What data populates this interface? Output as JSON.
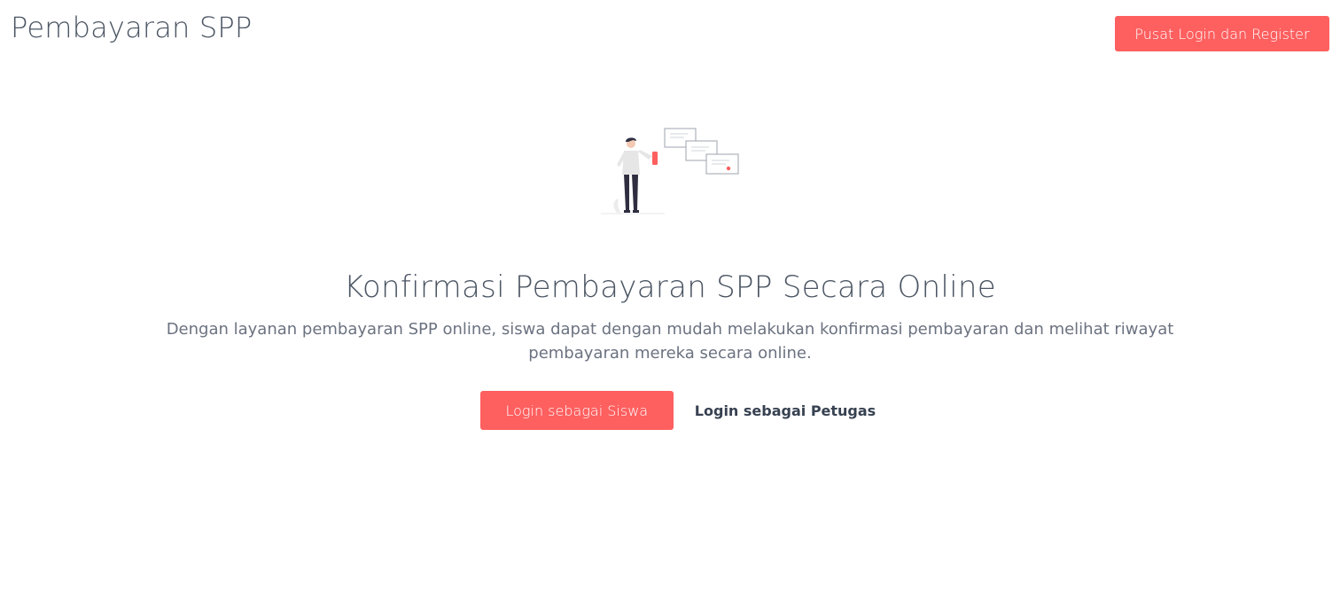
{
  "header": {
    "brand_title": "Pembayaran SPP",
    "login_register_label": "Pusat Login dan Register"
  },
  "hero": {
    "illustration_icon": "person-with-phone-messages-illustration",
    "title": "Konfirmasi Pembayaran SPP Secara Online",
    "description": "Dengan layanan pembayaran SPP online, siswa dapat dengan mudah melakukan konfirmasi pembayaran dan melihat riwayat pembayaran mereka secara online.",
    "student_login_label": "Login sebagai Siswa",
    "officer_login_label": "Login sebagai Petugas"
  },
  "colors": {
    "accent": "#fe5f5f",
    "text": "#4b5563",
    "muted": "#6b7280"
  }
}
